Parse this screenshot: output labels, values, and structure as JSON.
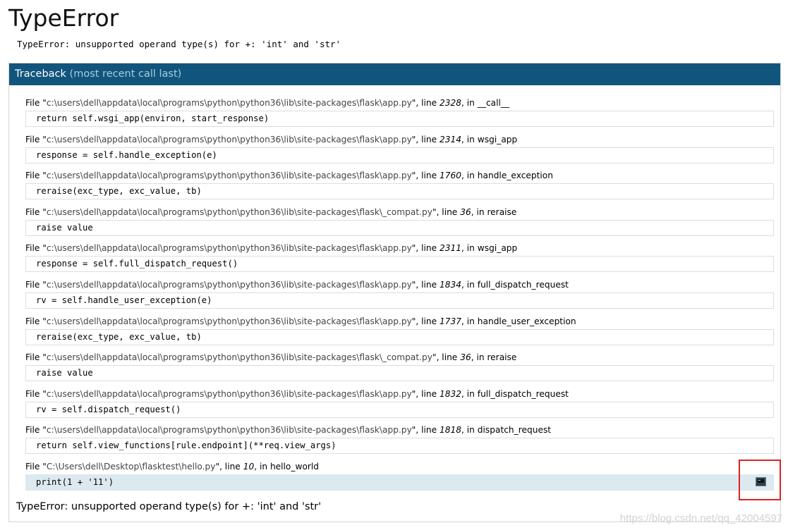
{
  "page": {
    "title": "TypeError",
    "message": "TypeError: unsupported operand type(s) for +: 'int' and 'str'"
  },
  "traceback": {
    "header_label": "Traceback",
    "header_sub": "(most recent call last)",
    "frames": [
      {
        "file": "c:\\users\\dell\\appdata\\local\\programs\\python\\python36\\lib\\site-packages\\flask\\app.py",
        "line": "2328",
        "func": "__call__",
        "code": "return self.wsgi_app(environ, start_response)"
      },
      {
        "file": "c:\\users\\dell\\appdata\\local\\programs\\python\\python36\\lib\\site-packages\\flask\\app.py",
        "line": "2314",
        "func": "wsgi_app",
        "code": "response = self.handle_exception(e)"
      },
      {
        "file": "c:\\users\\dell\\appdata\\local\\programs\\python\\python36\\lib\\site-packages\\flask\\app.py",
        "line": "1760",
        "func": "handle_exception",
        "code": "reraise(exc_type, exc_value, tb)"
      },
      {
        "file": "c:\\users\\dell\\appdata\\local\\programs\\python\\python36\\lib\\site-packages\\flask\\_compat.py",
        "line": "36",
        "func": "reraise",
        "code": "raise value"
      },
      {
        "file": "c:\\users\\dell\\appdata\\local\\programs\\python\\python36\\lib\\site-packages\\flask\\app.py",
        "line": "2311",
        "func": "wsgi_app",
        "code": "response = self.full_dispatch_request()"
      },
      {
        "file": "c:\\users\\dell\\appdata\\local\\programs\\python\\python36\\lib\\site-packages\\flask\\app.py",
        "line": "1834",
        "func": "full_dispatch_request",
        "code": "rv = self.handle_user_exception(e)"
      },
      {
        "file": "c:\\users\\dell\\appdata\\local\\programs\\python\\python36\\lib\\site-packages\\flask\\app.py",
        "line": "1737",
        "func": "handle_user_exception",
        "code": "reraise(exc_type, exc_value, tb)"
      },
      {
        "file": "c:\\users\\dell\\appdata\\local\\programs\\python\\python36\\lib\\site-packages\\flask\\_compat.py",
        "line": "36",
        "func": "reraise",
        "code": "raise value"
      },
      {
        "file": "c:\\users\\dell\\appdata\\local\\programs\\python\\python36\\lib\\site-packages\\flask\\app.py",
        "line": "1832",
        "func": "full_dispatch_request",
        "code": "rv = self.dispatch_request()"
      },
      {
        "file": "c:\\users\\dell\\appdata\\local\\programs\\python\\python36\\lib\\site-packages\\flask\\app.py",
        "line": "1818",
        "func": "dispatch_request",
        "code": "return self.view_functions[rule.endpoint](**req.view_args)"
      },
      {
        "file": "C:\\Users\\dell\\Desktop\\flasktest\\hello.py",
        "line": "10",
        "func": "hello_world",
        "code": "print(1 + '11')",
        "current": true,
        "console_icon": "terminal-icon"
      }
    ],
    "labels": {
      "file": "File ",
      "line": ", line ",
      "in": ", in "
    },
    "final_error": "TypeError: unsupported operand type(s) for +: 'int' and 'str'"
  },
  "watermark": "https://blog.csdn.net/qq_42004597",
  "colors": {
    "header_bg": "#11557c",
    "header_muted": "#a6cbe0",
    "current_frame_bg": "#dce9ee",
    "annotation_border": "#e02020"
  }
}
